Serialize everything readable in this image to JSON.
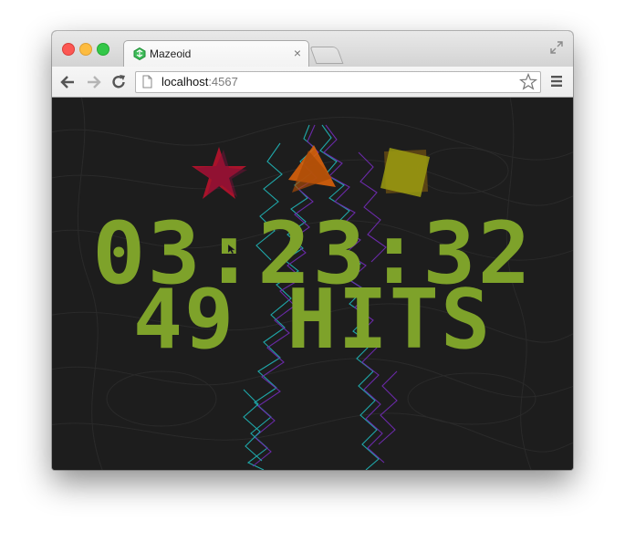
{
  "browser": {
    "tab_title": "Mazeoid",
    "new_tab_label": "",
    "url_host": "localhost",
    "url_port": ":4567"
  },
  "icons": {
    "back": "back-arrow-icon",
    "forward": "forward-arrow-icon",
    "reload": "reload-icon",
    "page": "page-icon",
    "bookmark": "star-icon",
    "menu": "hamburger-menu-icon",
    "favicon": "mazeoid-favicon-icon",
    "fullscreen": "fullscreen-icon"
  },
  "game": {
    "timer": "03:23:32",
    "hits": "49 HITS",
    "colors": {
      "hud": "#7ea22a",
      "background": "#1d1d1d",
      "star": "#b0132b",
      "triangle": "#d9620b",
      "square": "#9c9c10",
      "maze_cyan": "#1fa7a9",
      "maze_purple": "#6a2aa8"
    }
  }
}
